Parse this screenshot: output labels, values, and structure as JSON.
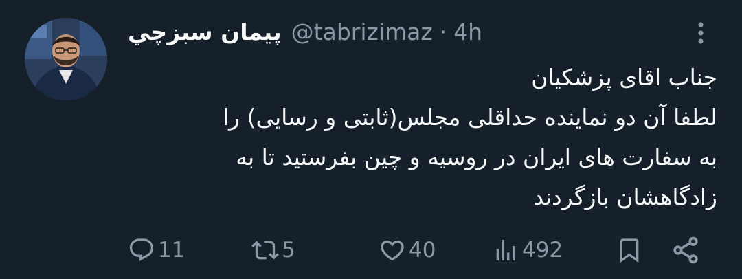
{
  "tweet": {
    "display_name": "پیمان سبزچي",
    "handle": "@tabrizimaz",
    "separator": "·",
    "time": "4h",
    "body_lines": [
      "جناب اقای پزشکیان",
      "لطفا آن دو نماینده حداقلی مجلس(ثابتی و رسایی) را",
      "به سفارت های ایران در روسیه و چین بفرستید تا به",
      "زادگاهشان بازگردند"
    ]
  },
  "actions": {
    "reply_count": "11",
    "retweet_count": "5",
    "like_count": "40",
    "views_count": "492",
    "icons": [
      "reply-icon",
      "retweet-icon",
      "like-icon",
      "views-icon",
      "bookmark-icon",
      "share-icon"
    ]
  },
  "colors": {
    "background": "#15202b",
    "text_primary": "#f7f9f9",
    "text_secondary": "#8b98a5"
  }
}
